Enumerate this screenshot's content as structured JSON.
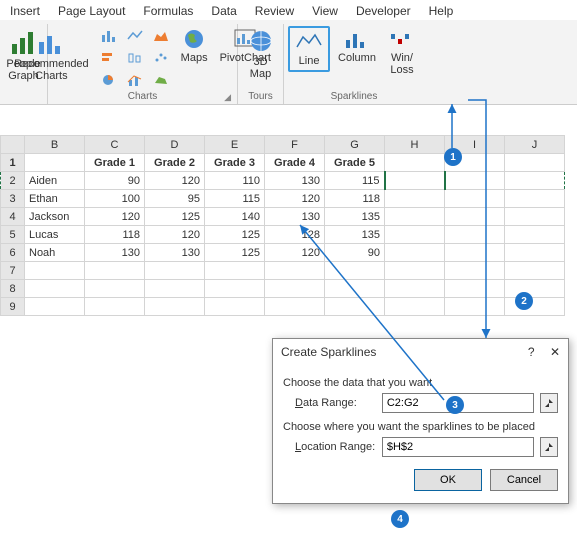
{
  "tabs": [
    "Insert",
    "Page Layout",
    "Formulas",
    "Data",
    "Review",
    "View",
    "Developer",
    "Help"
  ],
  "ribbon": {
    "people_graph": "People\nGraph",
    "rec_charts": "Recommended\nCharts",
    "charts_label": "Charts",
    "maps": "Maps",
    "pivotchart": "PivotChart",
    "map3d": "3D\nMap",
    "tours_label": "Tours",
    "line": "Line",
    "column": "Column",
    "winloss": "Win/\nLoss",
    "spark_label": "Sparklines"
  },
  "sheet": {
    "cols": [
      "B",
      "C",
      "D",
      "E",
      "F",
      "G",
      "H",
      "I",
      "J"
    ],
    "headers": [
      "",
      "Grade 1",
      "Grade 2",
      "Grade 3",
      "Grade 4",
      "Grade 5",
      "",
      "",
      ""
    ],
    "rows": [
      {
        "name": "Aiden",
        "v": [
          90,
          120,
          110,
          130,
          115
        ]
      },
      {
        "name": "Ethan",
        "v": [
          100,
          95,
          115,
          120,
          118
        ]
      },
      {
        "name": "Jackson",
        "v": [
          120,
          125,
          140,
          130,
          135
        ]
      },
      {
        "name": "Lucas",
        "v": [
          118,
          120,
          125,
          128,
          135
        ]
      },
      {
        "name": "Noah",
        "v": [
          130,
          130,
          125,
          120,
          90
        ]
      }
    ]
  },
  "dialog": {
    "title": "Create Sparklines",
    "sect1": "Choose the data that you want",
    "data_range_lbl": "Data Range:",
    "data_range_val": "C2:G2",
    "sect2": "Choose where you want the sparklines to be placed",
    "loc_range_lbl": "Location Range:",
    "loc_range_val": "$H$2",
    "ok": "OK",
    "cancel": "Cancel"
  },
  "callouts": {
    "c1": "1",
    "c2": "2",
    "c3": "3",
    "c4": "4"
  }
}
